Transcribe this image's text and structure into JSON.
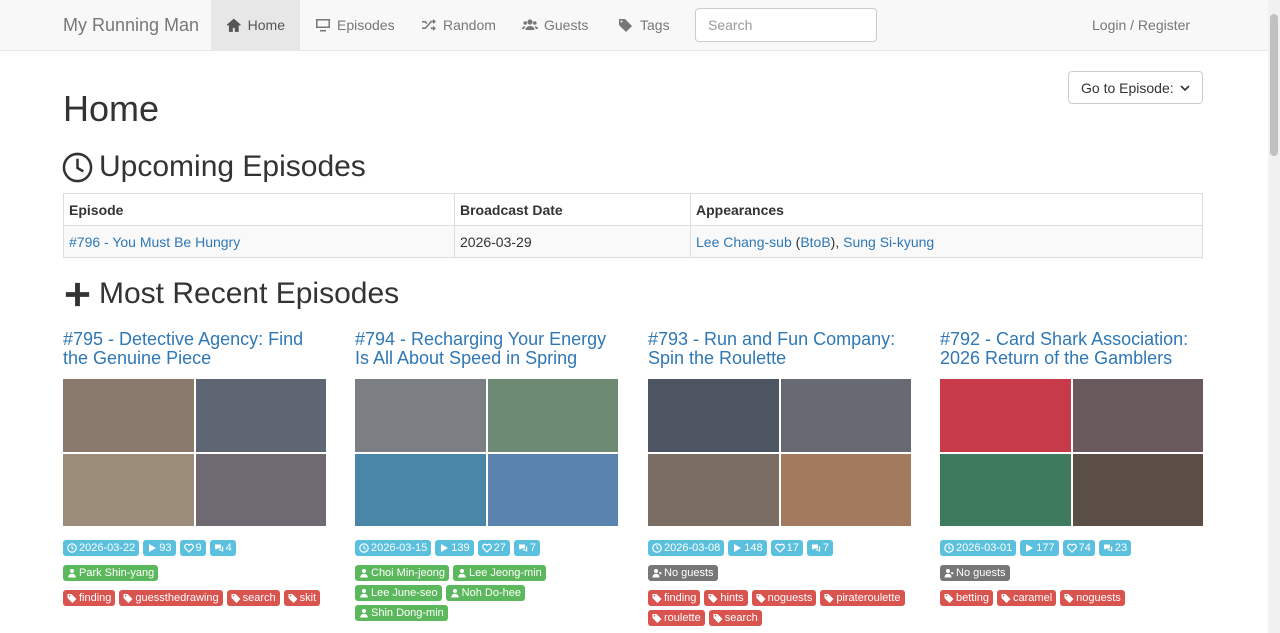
{
  "nav": {
    "brand": "My Running Man",
    "items": [
      {
        "label": "Home",
        "icon": "home-icon"
      },
      {
        "label": "Episodes",
        "icon": "tv-icon"
      },
      {
        "label": "Random",
        "icon": "shuffle-icon"
      },
      {
        "label": "Guests",
        "icon": "users-icon"
      },
      {
        "label": "Tags",
        "icon": "tags-icon"
      }
    ],
    "search_placeholder": "Search",
    "login": "Login / Register"
  },
  "goto_label": "Go to Episode:",
  "page_title": "Home",
  "upcoming": {
    "title": "Upcoming Episodes",
    "headers": [
      "Episode",
      "Broadcast Date",
      "Appearances"
    ],
    "row": {
      "episode": "#796 - You Must Be Hungry",
      "date": "2026-03-29",
      "guest1": "Lee Chang-sub",
      "paren_open": " (",
      "group": "BtoB",
      "paren_close": "), ",
      "guest2": "Sung Si-kyung"
    }
  },
  "recent": {
    "title": "Most Recent Episodes",
    "episodes": [
      {
        "title": "#795 - Detective Agency: Find the Genuine Piece",
        "date": "2026-03-22",
        "views": "93",
        "likes": "9",
        "comments": "4",
        "guests": [
          "Park Shin-yang"
        ],
        "tags": [
          "finding",
          "guessthedrawing",
          "search",
          "skit"
        ]
      },
      {
        "title": "#794 - Recharging Your Energy Is All About Speed in Spring",
        "date": "2026-03-15",
        "views": "139",
        "likes": "27",
        "comments": "7",
        "guests": [
          "Choi Min-jeong",
          "Lee Jeong-min",
          "Lee June-seo",
          "Noh Do-hee",
          "Shin Dong-min"
        ],
        "tags": []
      },
      {
        "title": "#793 - Run and Fun Company: Spin the Roulette",
        "date": "2026-03-08",
        "views": "148",
        "likes": "17",
        "comments": "7",
        "guests": [],
        "no_guests": "No guests",
        "tags": [
          "finding",
          "hints",
          "noguests",
          "pirateroulette",
          "roulette",
          "search"
        ]
      },
      {
        "title": "#792 - Card Shark Association: 2026 Return of the Gamblers",
        "date": "2026-03-01",
        "views": "177",
        "likes": "74",
        "comments": "23",
        "guests": [],
        "no_guests": "No guests",
        "tags": [
          "betting",
          "caramel",
          "noguests"
        ]
      }
    ]
  },
  "colors": {
    "link": "#2f78b5",
    "info": "#5bc0de",
    "success": "#5cb85c",
    "danger": "#d9534f",
    "default": "#777777"
  }
}
